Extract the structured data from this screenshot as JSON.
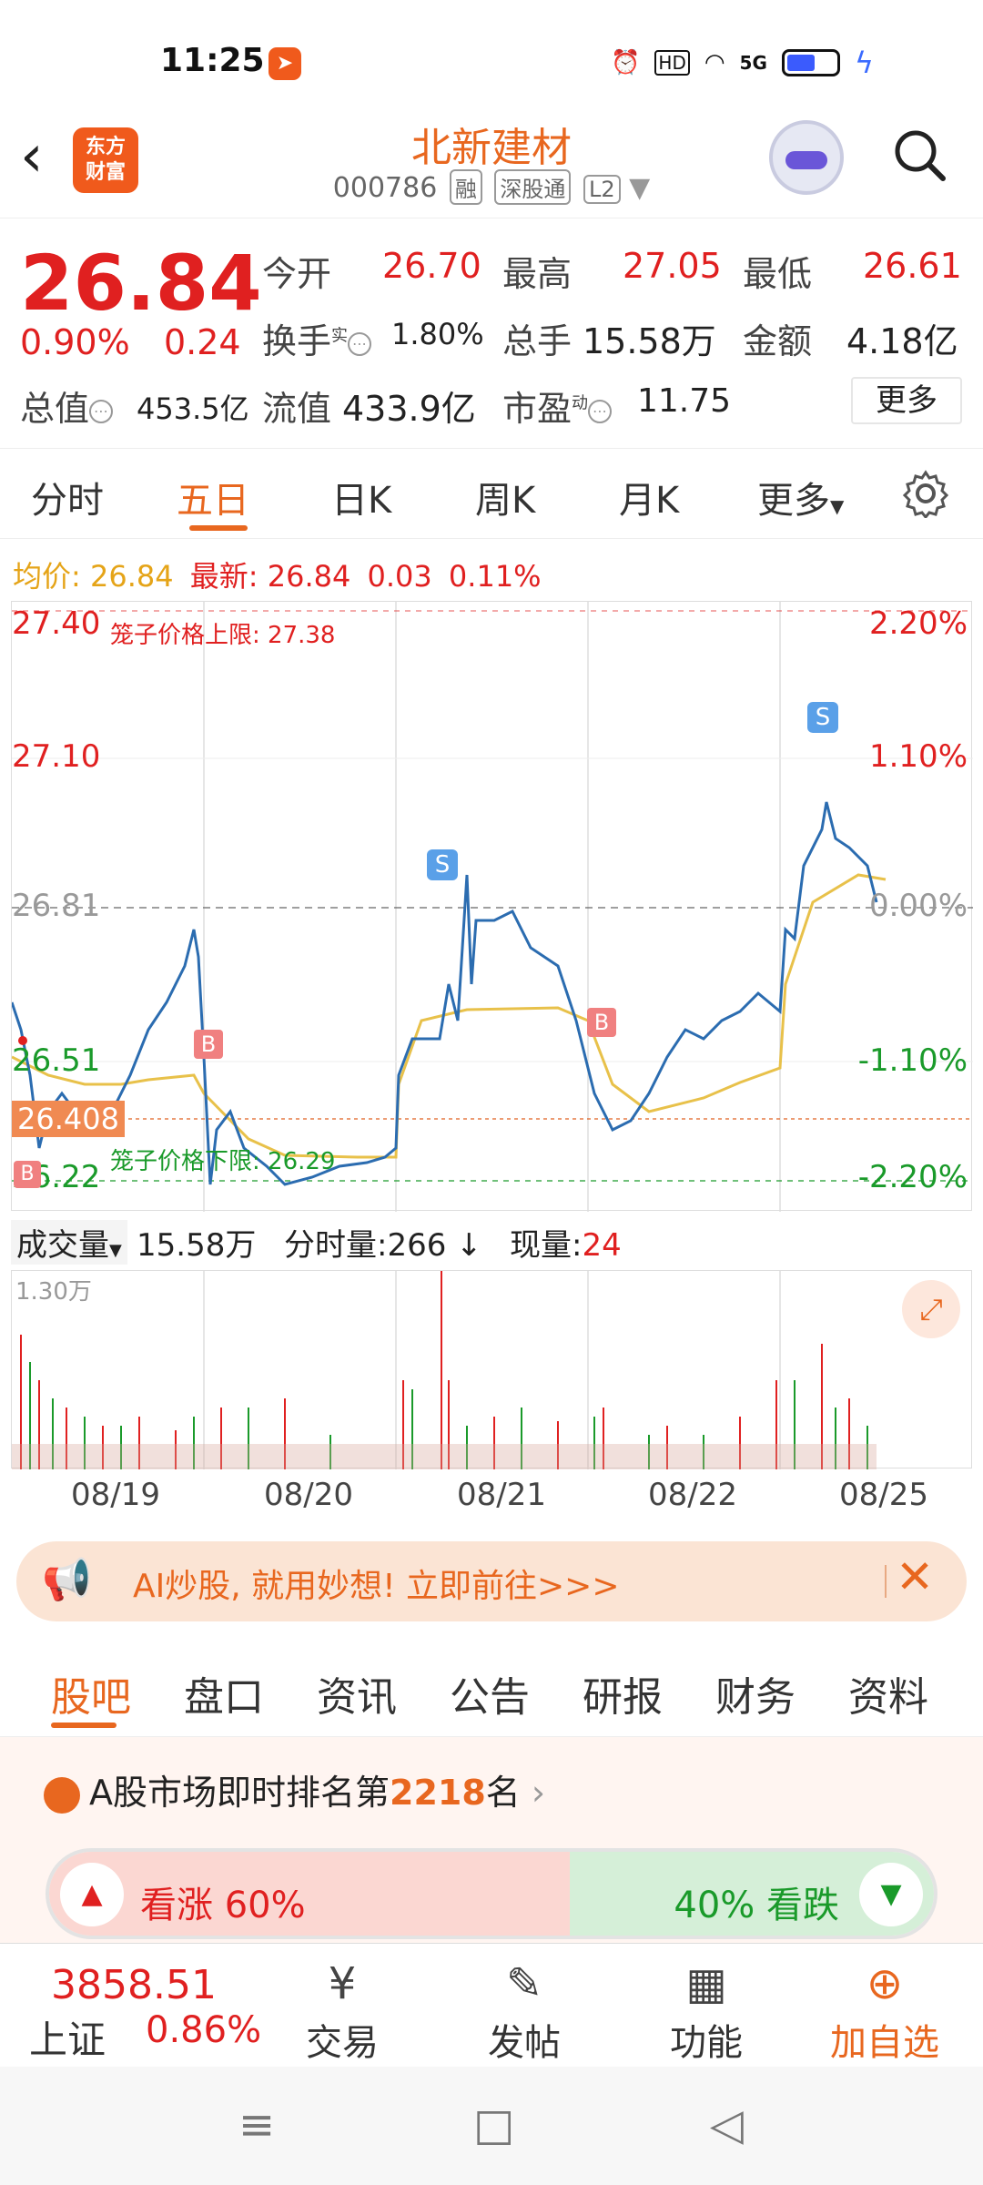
{
  "status": {
    "time": "11:25",
    "net": "5G",
    "hd": "HD"
  },
  "header": {
    "title": "北新建材",
    "code": "000786",
    "tags": [
      "融",
      "深股通",
      "L2"
    ],
    "logo": "东方\n财富",
    "logo_line1": "东方",
    "logo_line2": "财富"
  },
  "quote": {
    "price": "26.84",
    "pct": "0.90%",
    "chg": "0.24",
    "open_label": "今开",
    "open": "26.70",
    "high_label": "最高",
    "high": "27.05",
    "low_label": "最低",
    "low": "26.61",
    "turnover_label": "换手",
    "turnover_sup": "实",
    "turnover": "1.80%",
    "volume_label": "总手",
    "volume": "15.58万",
    "amount_label": "金额",
    "amount": "4.18亿",
    "mcap_label": "总值",
    "mcap": "453.5亿",
    "float_label": "流值",
    "float": "433.9亿",
    "pe_label": "市盈",
    "pe_sup": "动",
    "pe": "11.75",
    "more": "更多"
  },
  "ktabs": [
    "分时",
    "五日",
    "日K",
    "周K",
    "月K",
    "更多"
  ],
  "avg": {
    "avg_label": "均价:",
    "avg": "26.84",
    "latest_label": "最新:",
    "latest": "26.84",
    "chg": "0.03",
    "pct": "0.11%"
  },
  "chart": {
    "y_left": [
      "27.40",
      "27.10",
      "26.81",
      "26.51",
      "26.22"
    ],
    "y_right": [
      "2.20%",
      "1.10%",
      "0.00%",
      "-1.10%",
      "-2.20%"
    ],
    "cage_upper": "笼子价格上限: 27.38",
    "cage_lower": "笼子价格下限: 26.29",
    "marker_price": "26.408",
    "marker_b": "B",
    "marker_s": "S"
  },
  "volume": {
    "label": "成交量",
    "total": "15.58万",
    "tick_label": "分时量:266",
    "now_label": "现量:",
    "now": "24",
    "ymax": "1.30万"
  },
  "dates": [
    "08/19",
    "08/20",
    "08/21",
    "08/22",
    "08/25"
  ],
  "ad": {
    "text": "AI炒股, 就用妙想! 立即前往>>>"
  },
  "btabs": [
    "股吧",
    "盘口",
    "资讯",
    "公告",
    "研报",
    "财务",
    "资料"
  ],
  "rank": {
    "prefix": "A股市场即时排名第",
    "num": "2218",
    "suffix": "名"
  },
  "vote": {
    "up": "看涨 60%",
    "down": "40% 看跌"
  },
  "bottom_nav": {
    "index_value": "3858.51",
    "index_name": "上证",
    "index_pct": "0.86%",
    "items": [
      "交易",
      "发帖",
      "功能",
      "加自选"
    ]
  },
  "chart_data": {
    "type": "line",
    "categories": [
      "08/19",
      "08/20",
      "08/21",
      "08/22",
      "08/25"
    ],
    "ylim": [
      26.22,
      27.4
    ],
    "series": []
  }
}
